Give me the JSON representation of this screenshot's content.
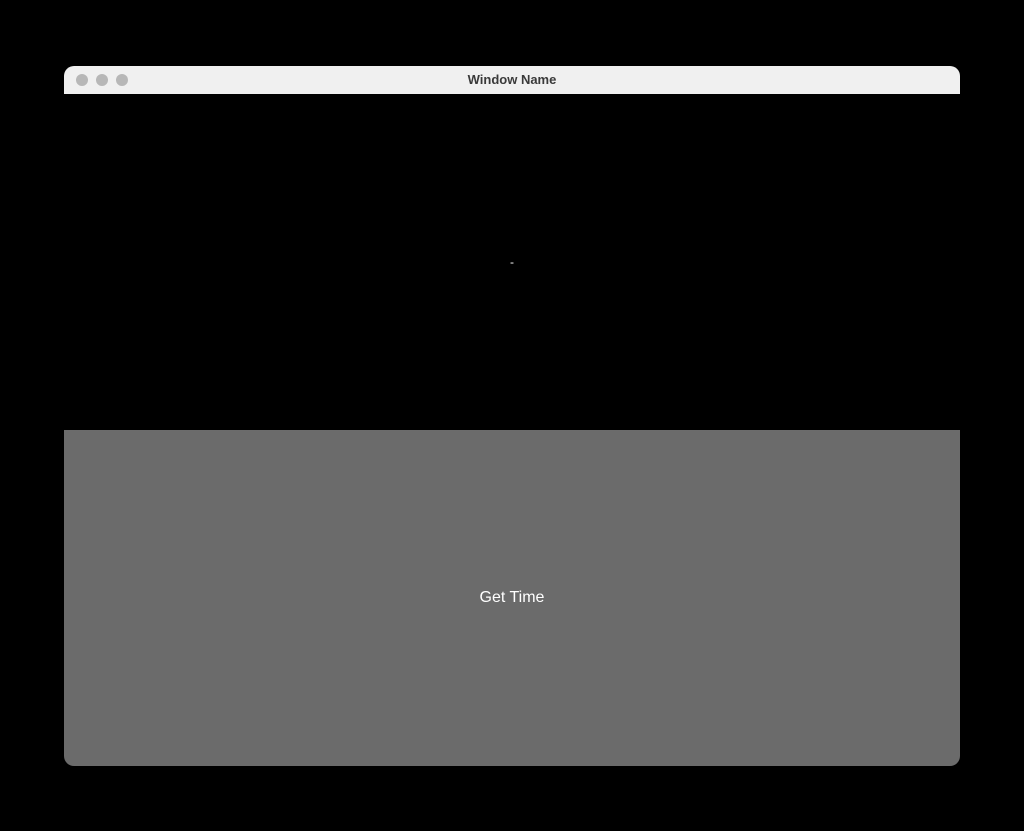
{
  "window": {
    "title": "Window Name"
  },
  "display": {
    "value": "-"
  },
  "button": {
    "label": "Get Time"
  }
}
